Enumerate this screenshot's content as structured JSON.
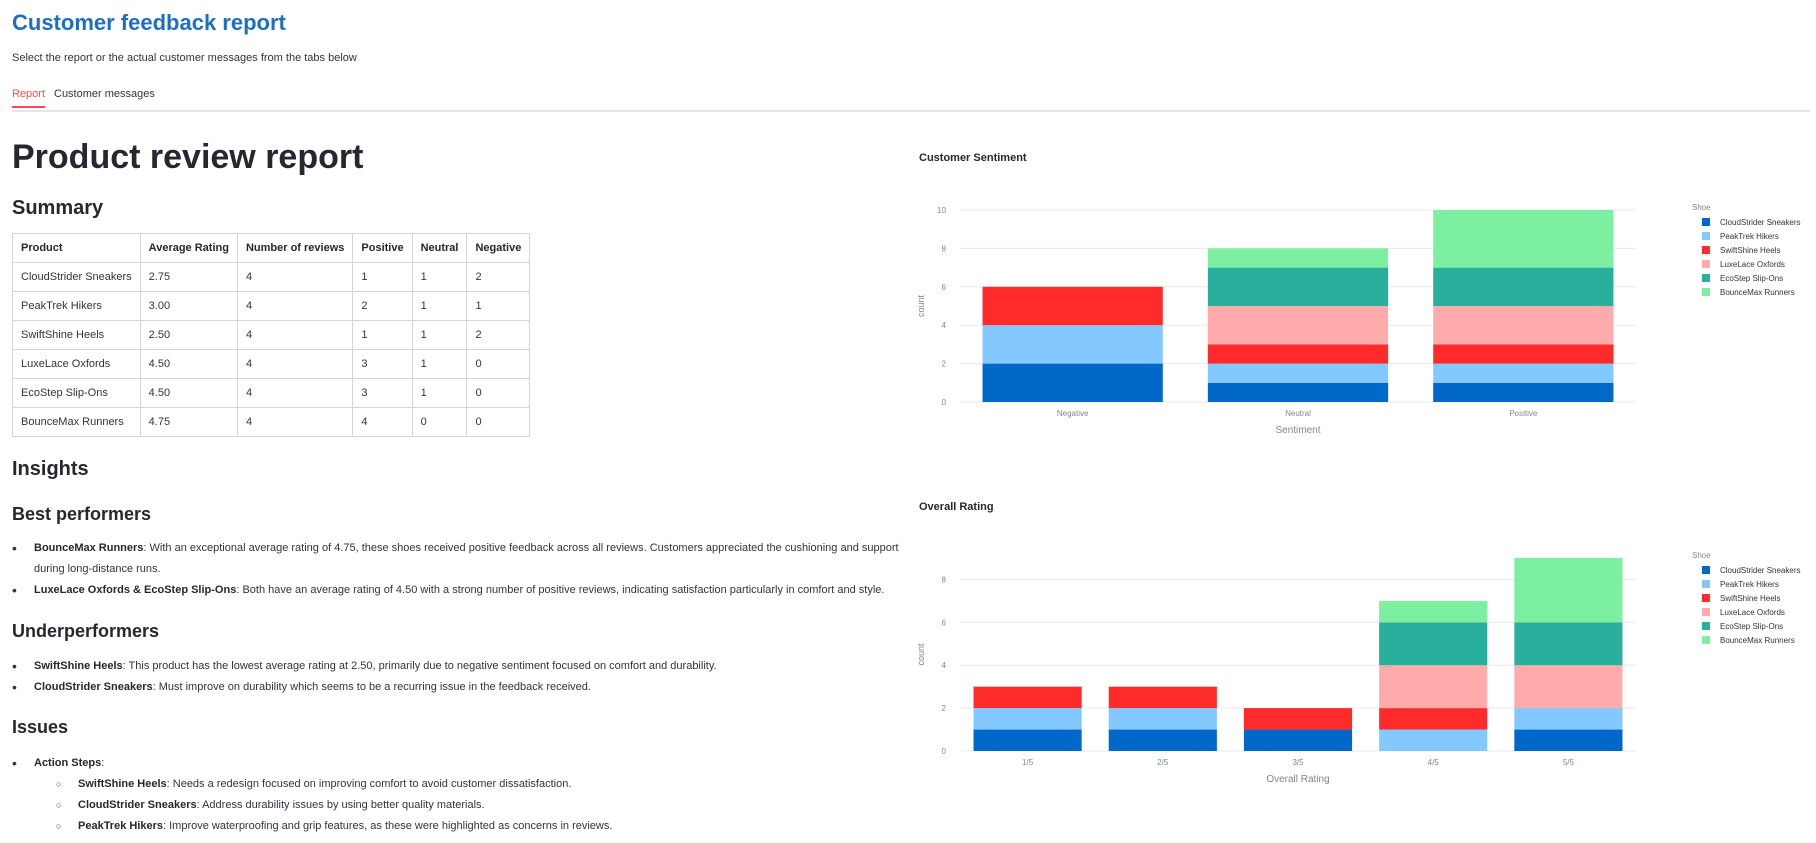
{
  "header": {
    "title": "Customer feedback report",
    "subtitle": "Select the report or the actual customer messages from the tabs below"
  },
  "tabs": [
    {
      "label": "Report",
      "active": true
    },
    {
      "label": "Customer messages",
      "active": false
    }
  ],
  "report": {
    "title": "Product review report",
    "summary_heading": "Summary",
    "table": {
      "headers": [
        "Product",
        "Average Rating",
        "Number of reviews",
        "Positive",
        "Neutral",
        "Negative"
      ],
      "rows": [
        [
          "CloudStrider Sneakers",
          "2.75",
          "4",
          "1",
          "1",
          "2"
        ],
        [
          "PeakTrek Hikers",
          "3.00",
          "4",
          "2",
          "1",
          "1"
        ],
        [
          "SwiftShine Heels",
          "2.50",
          "4",
          "1",
          "1",
          "2"
        ],
        [
          "LuxeLace Oxfords",
          "4.50",
          "4",
          "3",
          "1",
          "0"
        ],
        [
          "EcoStep Slip-Ons",
          "4.50",
          "4",
          "3",
          "1",
          "0"
        ],
        [
          "BounceMax Runners",
          "4.75",
          "4",
          "4",
          "0",
          "0"
        ]
      ]
    },
    "insights_heading": "Insights",
    "best": {
      "heading": "Best performers",
      "items": [
        {
          "bold": "BounceMax Runners",
          "text": ": With an exceptional average rating of 4.75, these shoes received positive feedback across all reviews. Customers appreciated the cushioning and support during long-distance runs."
        },
        {
          "bold": "LuxeLace Oxfords & EcoStep Slip-Ons",
          "text": ": Both have an average rating of 4.50 with a strong number of positive reviews, indicating satisfaction particularly in comfort and style."
        }
      ]
    },
    "under": {
      "heading": "Underperformers",
      "items": [
        {
          "bold": "SwiftShine Heels",
          "text": ": This product has the lowest average rating at 2.50, primarily due to negative sentiment focused on comfort and durability."
        },
        {
          "bold": "CloudStrider Sneakers",
          "text": ": Must improve on durability which seems to be a recurring issue in the feedback received."
        }
      ]
    },
    "issues": {
      "heading": "Issues",
      "action_label": "Action Steps",
      "action_suffix": ":",
      "items": [
        {
          "bold": "SwiftShine Heels",
          "text": ": Needs a redesign focused on improving comfort to avoid customer dissatisfaction."
        },
        {
          "bold": "CloudStrider Sneakers",
          "text": ": Address durability issues by using better quality materials."
        },
        {
          "bold": "PeakTrek Hikers",
          "text": ": Improve waterproofing and grip features, as these were highlighted as concerns in reviews."
        }
      ]
    }
  },
  "colors": {
    "CloudStrider Sneakers": "#0068c9",
    "PeakTrek Hikers": "#83c9ff",
    "SwiftShine Heels": "#ff2b2b",
    "LuxeLace Oxfords": "#ffabab",
    "EcoStep Slip-Ons": "#29b09d",
    "BounceMax Runners": "#7defa1",
    "accent": "#1c6fc4",
    "tab_active": "#ff4b4b"
  },
  "chart_data": [
    {
      "type": "bar",
      "stacked": true,
      "title": "Customer Sentiment",
      "xlabel": "Sentiment",
      "ylabel": "count",
      "legend_title": "Shoe",
      "legend_position": "right",
      "categories": [
        "Negative",
        "Neutral",
        "Positive"
      ],
      "ylim": [
        0,
        10
      ],
      "yticks": [
        0,
        2,
        4,
        6,
        8,
        10
      ],
      "series": [
        {
          "name": "CloudStrider Sneakers",
          "values": [
            2,
            1,
            1
          ]
        },
        {
          "name": "PeakTrek Hikers",
          "values": [
            2,
            1,
            1
          ]
        },
        {
          "name": "SwiftShine Heels",
          "values": [
            2,
            1,
            1
          ]
        },
        {
          "name": "LuxeLace Oxfords",
          "values": [
            0,
            2,
            2
          ]
        },
        {
          "name": "EcoStep Slip-Ons",
          "values": [
            0,
            2,
            2
          ]
        },
        {
          "name": "BounceMax Runners",
          "values": [
            0,
            1,
            3
          ]
        }
      ]
    },
    {
      "type": "bar",
      "stacked": true,
      "title": "Overall Rating",
      "xlabel": "Overall Rating",
      "ylabel": "count",
      "legend_title": "Shoe",
      "legend_position": "right",
      "categories": [
        "1/5",
        "2/5",
        "3/5",
        "4/5",
        "5/5"
      ],
      "ylim": [
        0,
        9
      ],
      "yticks": [
        0,
        2,
        4,
        6,
        8
      ],
      "series": [
        {
          "name": "CloudStrider Sneakers",
          "values": [
            1,
            1,
            1,
            0,
            1
          ]
        },
        {
          "name": "PeakTrek Hikers",
          "values": [
            1,
            1,
            0,
            1,
            1
          ]
        },
        {
          "name": "SwiftShine Heels",
          "values": [
            1,
            1,
            1,
            1,
            0
          ]
        },
        {
          "name": "LuxeLace Oxfords",
          "values": [
            0,
            0,
            0,
            2,
            2
          ]
        },
        {
          "name": "EcoStep Slip-Ons",
          "values": [
            0,
            0,
            0,
            2,
            2
          ]
        },
        {
          "name": "BounceMax Runners",
          "values": [
            0,
            0,
            0,
            1,
            3
          ]
        }
      ]
    }
  ]
}
